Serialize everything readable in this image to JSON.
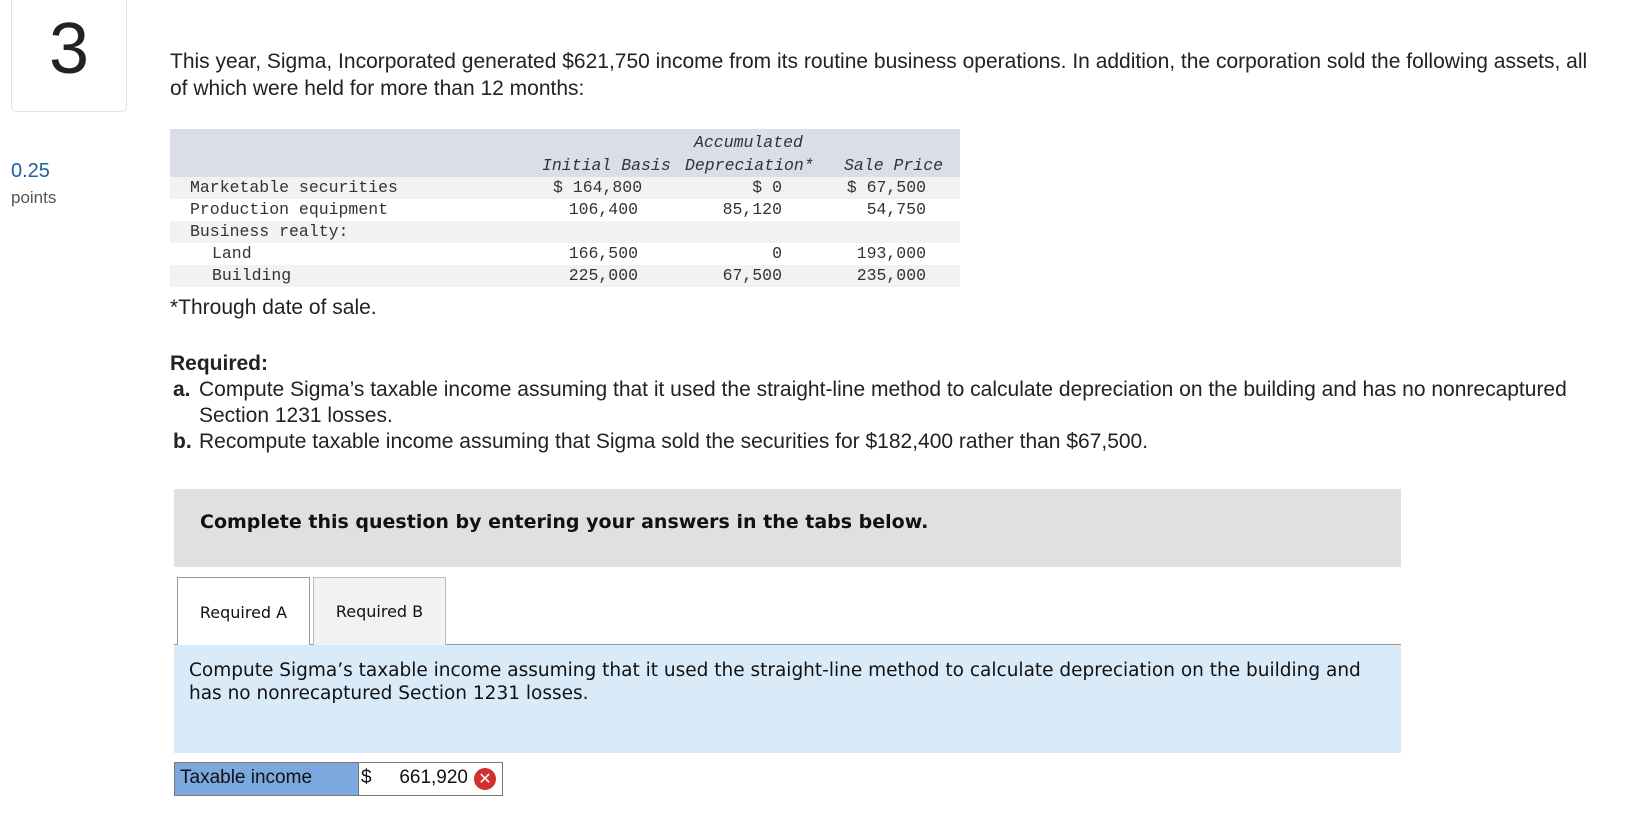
{
  "question": {
    "number": "3",
    "points_value": "0.25",
    "points_label": "points",
    "intro": "This year, Sigma, Incorporated generated $621,750 income from its routine business operations. In addition, the corporation sold the following assets, all of which were held for more than 12 months:"
  },
  "assets_table": {
    "headers": {
      "initial_basis": "Initial Basis",
      "accum_line1": "Accumulated",
      "accum_line2": "Depreciation*",
      "sale_price": "Sale Price"
    },
    "rows": [
      {
        "label": "Marketable securities",
        "initial": "$ 164,800",
        "accum": "$ 0",
        "sale": "$ 67,500"
      },
      {
        "label": "Production equipment",
        "initial": "106,400",
        "accum": "85,120",
        "sale": "54,750"
      },
      {
        "label": "Business realty:",
        "initial": "",
        "accum": "",
        "sale": ""
      },
      {
        "label": "Land",
        "initial": "166,500",
        "accum": "0",
        "sale": "193,000"
      },
      {
        "label": "Building",
        "initial": "225,000",
        "accum": "67,500",
        "sale": "235,000"
      }
    ],
    "footnote": "*Through date of sale."
  },
  "required": {
    "title": "Required:",
    "a_letter": "a.",
    "a_text": "Compute Sigma’s taxable income assuming that it used the straight-line method to calculate depreciation on the building and has no nonrecaptured Section 1231 losses.",
    "b_letter": "b.",
    "b_text": "Recompute taxable income assuming that Sigma sold the securities for $182,400 rather than $67,500."
  },
  "instructions": "Complete this question by entering your answers in the tabs below.",
  "tabs": [
    {
      "label": "Required A",
      "active": true
    },
    {
      "label": "Required B",
      "active": false
    }
  ],
  "panel_text": "Compute Sigma’s taxable income assuming that it used the straight-line method to calculate depreciation on the building and has no nonrecaptured Section 1231 losses.",
  "answer": {
    "label": "Taxable income",
    "currency": "$",
    "value": "661,920",
    "status": "incorrect"
  },
  "colors": {
    "table_header": "#d9dee8",
    "panel_bg": "#d9eaf8",
    "answer_label_bg": "#7ba9df",
    "incorrect": "#d32f2f",
    "points_blue": "#1f5f9e"
  }
}
